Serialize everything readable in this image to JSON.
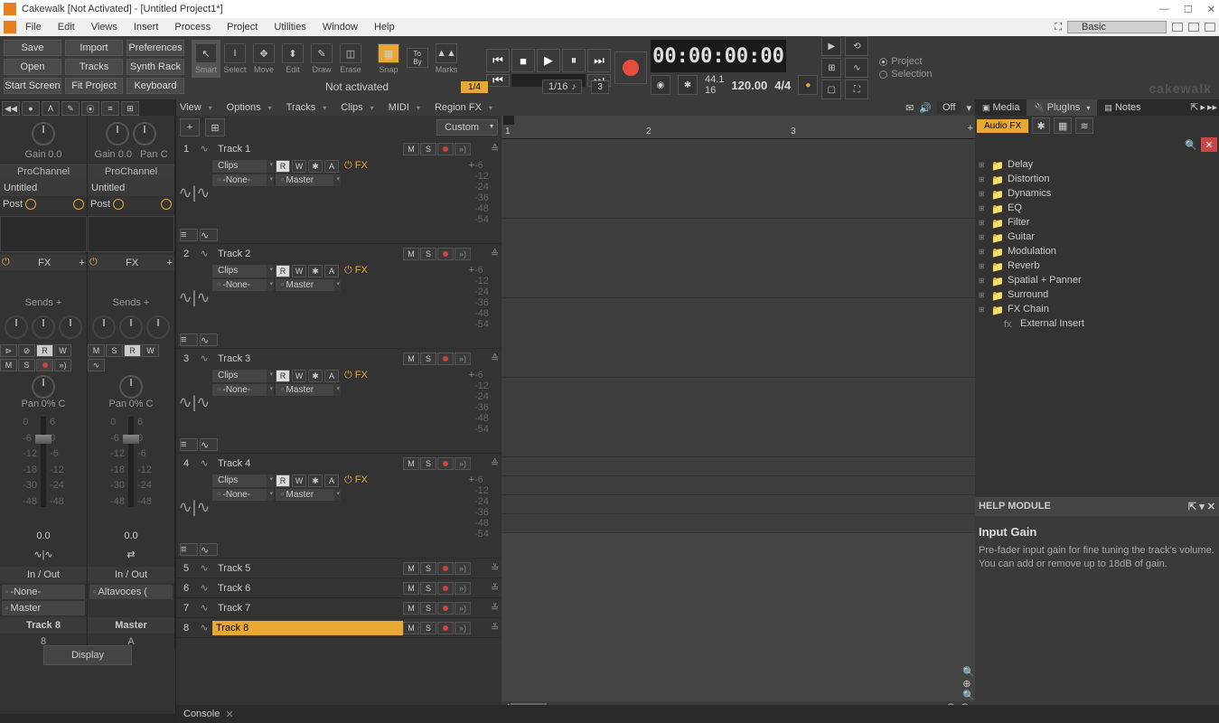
{
  "window": {
    "title": "Cakewalk [Not Activated] - [Untitled Project1*]",
    "min": "—",
    "max": "☐",
    "close": "✕"
  },
  "workspace": "Basic",
  "menu": [
    "File",
    "Edit",
    "Views",
    "Insert",
    "Process",
    "Project",
    "Utilities",
    "Window",
    "Help"
  ],
  "toolbar": {
    "buttons": [
      [
        "Save",
        "Import",
        "Preferences"
      ],
      [
        "Open",
        "Tracks",
        "Synth Rack"
      ],
      [
        "Start Screen",
        "Fit Project",
        "Keyboard"
      ]
    ],
    "tools": [
      "Smart",
      "Select",
      "Move",
      "Edit",
      "Draw",
      "Erase"
    ],
    "snap": "Snap",
    "marks": "Marks",
    "status": "Not activated",
    "quant1": "1/4",
    "quant2": "1/16",
    "tuplet": "3"
  },
  "transport": {
    "time": "00:00:00:00",
    "sr_top": "44.1",
    "sr_bot": "16",
    "tempo": "120.00",
    "sig": "4/4"
  },
  "search_mode": {
    "opt1": "Project",
    "opt2": "Selection"
  },
  "brand": "cakewalk",
  "viewbar": [
    "View",
    "Options",
    "Tracks",
    "Clips",
    "MIDI",
    "Region FX"
  ],
  "viewbar_off": "Off",
  "track_header": {
    "custom": "Custom"
  },
  "tracks": [
    {
      "num": "1",
      "name": "Track 1",
      "clips": "Clips",
      "input": "-None-",
      "output": "Master",
      "fx": "FX",
      "expanded": true
    },
    {
      "num": "2",
      "name": "Track 2",
      "clips": "Clips",
      "input": "-None-",
      "output": "Master",
      "fx": "FX",
      "expanded": true
    },
    {
      "num": "3",
      "name": "Track 3",
      "clips": "Clips",
      "input": "-None-",
      "output": "Master",
      "fx": "FX",
      "expanded": true
    },
    {
      "num": "4",
      "name": "Track 4",
      "clips": "Clips",
      "input": "-None-",
      "output": "Master",
      "fx": "FX",
      "expanded": true
    },
    {
      "num": "5",
      "name": "Track 5",
      "expanded": false
    },
    {
      "num": "6",
      "name": "Track 6",
      "expanded": false
    },
    {
      "num": "7",
      "name": "Track 7",
      "expanded": false
    },
    {
      "num": "8",
      "name": "Track 8",
      "expanded": false,
      "editing": true
    }
  ],
  "track_btns": {
    "m": "M",
    "s": "S",
    "r": "R",
    "w": "W",
    "a": "A",
    "star": "✱"
  },
  "ruler": {
    "marks": [
      "1",
      "2",
      "3"
    ]
  },
  "inspector": {
    "strip1": {
      "gain_lbl": "Gain",
      "gain_v": "0.0",
      "pro": "ProChannel",
      "name": "Untitled",
      "post": "Post",
      "fx": "FX",
      "sends": "Sends",
      "pan_lbl": "Pan",
      "pan_v": "0% C",
      "val": "0.0",
      "io": "In / Out",
      "in": "-None-",
      "out": "Master",
      "tname": "Track 8",
      "tnum": "8"
    },
    "strip2": {
      "gain_lbl": "Gain",
      "gain_v": "0.0",
      "pan_lbl2": "Pan",
      "pan_v2": "C",
      "pro": "ProChannel",
      "name": "Untitled",
      "post": "Post",
      "fx": "FX",
      "sends": "Sends",
      "pan_lbl": "Pan",
      "pan_v": "0% C",
      "val": "0.0",
      "io": "In / Out",
      "out": "Altavoces (",
      "tname": "Master",
      "tnum": "A"
    },
    "display_btn": "Display"
  },
  "right_panel": {
    "tabs": [
      "Media",
      "PlugIns",
      "Notes"
    ],
    "audio_fx": "Audio FX",
    "plugins": [
      "Delay",
      "Distortion",
      "Dynamics",
      "EQ",
      "Filter",
      "Guitar",
      "Modulation",
      "Reverb",
      "Spatial + Panner",
      "Surround",
      "FX Chain",
      "External Insert"
    ],
    "help_hd": "HELP MODULE",
    "help_title": "Input Gain",
    "help_body1": "Pre-fader input gain for fine tuning the track's volume.",
    "help_body2": "You can add or remove up to 18dB of gain."
  },
  "bottom": {
    "console": "Console"
  }
}
